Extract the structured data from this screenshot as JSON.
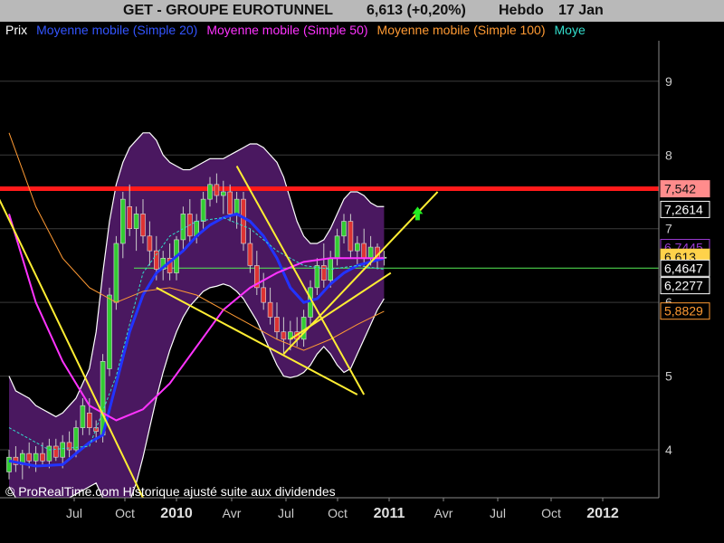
{
  "header": {
    "title": "GET - GROUPE EUROTUNNEL",
    "price": "6,613 (+0,20%)",
    "period": "Hebdo",
    "date": "17 Jan"
  },
  "legend": [
    {
      "label": "Prix",
      "color": "#ffffff"
    },
    {
      "label": "Moyenne mobile (Simple 20)",
      "color": "#3355ff"
    },
    {
      "label": "Moyenne mobile (Simple 50)",
      "color": "#ff33ff"
    },
    {
      "label": "Moyenne mobile (Simple 100)",
      "color": "#ff9a33"
    },
    {
      "label": "Moye",
      "color": "#33ddcc"
    }
  ],
  "footer_note": "© ProRealTime.com Historique ajusté suite aux dividendes",
  "chart_data": {
    "type": "candlestick",
    "ylim": [
      3.35,
      9.55
    ],
    "y_ticks": [
      4,
      5,
      6,
      7,
      8,
      9
    ],
    "x_ticks": [
      {
        "label": "Jul",
        "bold": false
      },
      {
        "label": "Oct",
        "bold": false
      },
      {
        "label": "2010",
        "bold": true
      },
      {
        "label": "Avr",
        "bold": false
      },
      {
        "label": "Jul",
        "bold": false
      },
      {
        "label": "Oct",
        "bold": false
      },
      {
        "label": "2011",
        "bold": true
      },
      {
        "label": "Avr",
        "bold": false
      },
      {
        "label": "Jul",
        "bold": false
      },
      {
        "label": "Oct",
        "bold": false
      },
      {
        "label": "2012",
        "bold": true
      }
    ],
    "horizontal_lines": [
      {
        "value": 7.542,
        "color": "#ff1a1a"
      },
      {
        "value": 6.4647,
        "color": "#55ee55"
      }
    ],
    "price_labels": [
      {
        "text": "7,542",
        "value": 7.542,
        "bg": "#ff8c8c",
        "fg": "#111111",
        "border": "#ff8c8c"
      },
      {
        "text": "7,2614",
        "value": 7.2614,
        "bg": "#000000",
        "fg": "#ffffff",
        "border": "#ffffff"
      },
      {
        "text": "6,7445",
        "value": 6.7445,
        "bg": "#000000",
        "fg": "#9a3ad0",
        "border": "#9a3ad0"
      },
      {
        "text": "6,613",
        "value": 6.613,
        "bg": "#ffd24a",
        "fg": "#111111",
        "border": "#ffd24a"
      },
      {
        "text": "6,4647",
        "value": 6.4647,
        "bg": "#000000",
        "fg": "#ffffff",
        "border": "#ffffff"
      },
      {
        "text": "6,2277",
        "value": 6.2277,
        "bg": "#000000",
        "fg": "#ffffff",
        "border": "#ffffff"
      },
      {
        "text": "5,8829",
        "value": 5.8829,
        "bg": "#000000",
        "fg": "#ff9a33",
        "border": "#ff9a33"
      }
    ],
    "bollinger_upper": [
      [
        0,
        5.0
      ],
      [
        1,
        4.8
      ],
      [
        2,
        4.75
      ],
      [
        3,
        4.7
      ],
      [
        4,
        4.6
      ],
      [
        5,
        4.55
      ],
      [
        6,
        4.5
      ],
      [
        7,
        4.45
      ],
      [
        8,
        4.5
      ],
      [
        9,
        4.6
      ],
      [
        10,
        4.7
      ],
      [
        11,
        4.9
      ],
      [
        12,
        5.1
      ],
      [
        13,
        5.6
      ],
      [
        14,
        6.4
      ],
      [
        15,
        7.1
      ],
      [
        16,
        7.6
      ],
      [
        17,
        7.9
      ],
      [
        18,
        8.1
      ],
      [
        19,
        8.2
      ],
      [
        20,
        8.3
      ],
      [
        21,
        8.3
      ],
      [
        22,
        8.2
      ],
      [
        23,
        8.0
      ],
      [
        24,
        7.9
      ],
      [
        25,
        7.85
      ],
      [
        26,
        7.8
      ],
      [
        27,
        7.8
      ],
      [
        28,
        7.85
      ],
      [
        29,
        7.9
      ],
      [
        30,
        7.95
      ],
      [
        31,
        7.95
      ],
      [
        32,
        7.95
      ],
      [
        33,
        8.0
      ],
      [
        34,
        8.05
      ],
      [
        35,
        8.1
      ],
      [
        36,
        8.15
      ],
      [
        37,
        8.15
      ],
      [
        38,
        8.1
      ],
      [
        39,
        8.0
      ],
      [
        40,
        7.9
      ],
      [
        41,
        7.7
      ],
      [
        42,
        7.4
      ],
      [
        43,
        7.1
      ],
      [
        44,
        6.9
      ],
      [
        45,
        6.8
      ],
      [
        46,
        6.8
      ],
      [
        47,
        6.85
      ],
      [
        48,
        7.0
      ],
      [
        49,
        7.2
      ],
      [
        50,
        7.4
      ],
      [
        51,
        7.5
      ],
      [
        52,
        7.5
      ],
      [
        53,
        7.45
      ],
      [
        54,
        7.35
      ],
      [
        55,
        7.3
      ],
      [
        56,
        7.3
      ]
    ],
    "bollinger_lower": [
      [
        0,
        3.5
      ],
      [
        1,
        3.35
      ],
      [
        2,
        3.3
      ],
      [
        3,
        3.28
      ],
      [
        4,
        3.26
      ],
      [
        5,
        3.25
      ],
      [
        6,
        3.25
      ],
      [
        7,
        3.27
      ],
      [
        8,
        3.3
      ],
      [
        9,
        3.35
      ],
      [
        10,
        3.4
      ],
      [
        11,
        3.45
      ],
      [
        12,
        3.5
      ],
      [
        13,
        3.55
      ],
      [
        14,
        3.35
      ],
      [
        15,
        3.0
      ],
      [
        16,
        2.95
      ],
      [
        17,
        3.1
      ],
      [
        18,
        3.3
      ],
      [
        19,
        3.55
      ],
      [
        20,
        3.9
      ],
      [
        21,
        4.3
      ],
      [
        22,
        4.7
      ],
      [
        23,
        5.05
      ],
      [
        24,
        5.35
      ],
      [
        25,
        5.6
      ],
      [
        26,
        5.8
      ],
      [
        27,
        5.95
      ],
      [
        28,
        6.05
      ],
      [
        29,
        6.15
      ],
      [
        30,
        6.2
      ],
      [
        31,
        6.22
      ],
      [
        32,
        6.25
      ],
      [
        33,
        6.22
      ],
      [
        34,
        6.15
      ],
      [
        35,
        6.05
      ],
      [
        36,
        5.9
      ],
      [
        37,
        5.75
      ],
      [
        38,
        5.55
      ],
      [
        39,
        5.35
      ],
      [
        40,
        5.15
      ],
      [
        41,
        5.0
      ],
      [
        42,
        4.98
      ],
      [
        43,
        5.0
      ],
      [
        44,
        5.05
      ],
      [
        45,
        5.15
      ],
      [
        46,
        5.3
      ],
      [
        47,
        5.4
      ],
      [
        48,
        5.3
      ],
      [
        49,
        5.15
      ],
      [
        50,
        5.05
      ],
      [
        51,
        5.1
      ],
      [
        52,
        5.3
      ],
      [
        53,
        5.5
      ],
      [
        54,
        5.7
      ],
      [
        55,
        5.9
      ],
      [
        56,
        6.05
      ]
    ],
    "candles": [
      [
        0,
        3.7,
        4.0,
        3.6,
        3.9
      ],
      [
        1,
        3.9,
        4.05,
        3.7,
        3.8
      ],
      [
        2,
        3.8,
        4.0,
        3.6,
        3.95
      ],
      [
        3,
        3.95,
        4.1,
        3.75,
        3.85
      ],
      [
        4,
        3.85,
        4.05,
        3.7,
        3.95
      ],
      [
        5,
        3.95,
        4.1,
        3.8,
        3.85
      ],
      [
        6,
        3.85,
        4.15,
        3.75,
        4.05
      ],
      [
        7,
        4.05,
        4.15,
        3.85,
        3.9
      ],
      [
        8,
        3.9,
        4.2,
        3.75,
        4.1
      ],
      [
        9,
        4.1,
        4.25,
        3.9,
        4.0
      ],
      [
        10,
        4.0,
        4.4,
        3.9,
        4.3
      ],
      [
        11,
        4.3,
        4.7,
        4.2,
        4.6
      ],
      [
        12,
        4.5,
        4.7,
        4.2,
        4.3
      ],
      [
        13,
        4.3,
        4.4,
        4.1,
        4.25
      ],
      [
        14,
        4.2,
        5.3,
        4.1,
        5.2
      ],
      [
        15,
        5.1,
        6.2,
        5.0,
        6.1
      ],
      [
        16,
        6.0,
        6.9,
        5.9,
        6.8
      ],
      [
        17,
        6.8,
        7.5,
        6.6,
        7.4
      ],
      [
        18,
        7.3,
        7.6,
        6.9,
        7.0
      ],
      [
        19,
        7.0,
        7.3,
        6.7,
        7.2
      ],
      [
        20,
        7.2,
        7.4,
        6.8,
        6.9
      ],
      [
        21,
        6.9,
        7.1,
        6.5,
        6.7
      ],
      [
        22,
        6.7,
        6.9,
        6.3,
        6.45
      ],
      [
        23,
        6.45,
        6.7,
        6.3,
        6.6
      ],
      [
        24,
        6.6,
        6.8,
        6.3,
        6.4
      ],
      [
        25,
        6.4,
        6.9,
        6.3,
        6.85
      ],
      [
        26,
        6.85,
        7.3,
        6.7,
        7.2
      ],
      [
        27,
        7.2,
        7.4,
        6.8,
        6.9
      ],
      [
        28,
        6.9,
        7.2,
        6.8,
        7.1
      ],
      [
        29,
        7.1,
        7.5,
        7.0,
        7.4
      ],
      [
        30,
        7.4,
        7.7,
        7.3,
        7.6
      ],
      [
        31,
        7.6,
        7.75,
        7.35,
        7.45
      ],
      [
        32,
        7.45,
        7.65,
        7.2,
        7.5
      ],
      [
        33,
        7.5,
        7.6,
        7.1,
        7.2
      ],
      [
        34,
        7.2,
        7.5,
        7.0,
        7.4
      ],
      [
        35,
        7.4,
        7.5,
        6.7,
        6.8
      ],
      [
        36,
        6.8,
        7.0,
        6.4,
        6.5
      ],
      [
        37,
        6.5,
        6.7,
        6.1,
        6.2
      ],
      [
        38,
        6.2,
        6.4,
        5.9,
        6.0
      ],
      [
        39,
        6.0,
        6.2,
        5.7,
        5.8
      ],
      [
        40,
        5.8,
        6.0,
        5.5,
        5.6
      ],
      [
        41,
        5.6,
        5.8,
        5.3,
        5.5
      ],
      [
        42,
        5.5,
        5.75,
        5.35,
        5.6
      ],
      [
        43,
        5.6,
        5.8,
        5.4,
        5.5
      ],
      [
        44,
        5.5,
        5.9,
        5.4,
        5.8
      ],
      [
        45,
        5.8,
        6.3,
        5.7,
        6.2
      ],
      [
        46,
        6.2,
        6.6,
        6.1,
        6.5
      ],
      [
        47,
        6.5,
        6.8,
        6.2,
        6.3
      ],
      [
        48,
        6.3,
        6.7,
        6.2,
        6.6
      ],
      [
        49,
        6.6,
        7.0,
        6.5,
        6.9
      ],
      [
        50,
        6.9,
        7.2,
        6.8,
        7.1
      ],
      [
        51,
        7.1,
        7.2,
        6.6,
        6.7
      ],
      [
        52,
        6.7,
        6.9,
        6.5,
        6.8
      ],
      [
        53,
        6.8,
        7.0,
        6.5,
        6.6
      ],
      [
        54,
        6.6,
        6.9,
        6.5,
        6.75
      ],
      [
        55,
        6.75,
        6.8,
        6.45,
        6.6
      ],
      [
        56,
        6.6,
        6.7,
        6.5,
        6.613
      ]
    ],
    "series": [
      {
        "name": "Moyenne mobile (Simple 20)",
        "color": "#2233ff",
        "width": 3,
        "points": [
          [
            0,
            3.85
          ],
          [
            4,
            3.78
          ],
          [
            8,
            3.8
          ],
          [
            12,
            4.1
          ],
          [
            14,
            4.2
          ],
          [
            16,
            4.9
          ],
          [
            18,
            5.6
          ],
          [
            20,
            6.1
          ],
          [
            22,
            6.4
          ],
          [
            24,
            6.55
          ],
          [
            26,
            6.7
          ],
          [
            28,
            6.9
          ],
          [
            30,
            7.05
          ],
          [
            32,
            7.15
          ],
          [
            34,
            7.2
          ],
          [
            36,
            7.1
          ],
          [
            38,
            6.9
          ],
          [
            40,
            6.6
          ],
          [
            42,
            6.2
          ],
          [
            44,
            6.0
          ],
          [
            46,
            6.05
          ],
          [
            48,
            6.25
          ],
          [
            50,
            6.4
          ],
          [
            52,
            6.5
          ],
          [
            54,
            6.55
          ],
          [
            56,
            6.6
          ]
        ]
      },
      {
        "name": "Moyenne mobile (Simple 50)",
        "color": "#ff33ff",
        "width": 2,
        "points": [
          [
            0,
            7.2
          ],
          [
            4,
            6.0
          ],
          [
            8,
            5.2
          ],
          [
            12,
            4.6
          ],
          [
            16,
            4.4
          ],
          [
            20,
            4.55
          ],
          [
            24,
            4.9
          ],
          [
            28,
            5.4
          ],
          [
            32,
            5.9
          ],
          [
            36,
            6.2
          ],
          [
            40,
            6.4
          ],
          [
            44,
            6.55
          ],
          [
            48,
            6.6
          ],
          [
            52,
            6.6
          ],
          [
            56,
            6.6
          ]
        ]
      },
      {
        "name": "Moyenne mobile (Simple 100)",
        "color": "#ff9a33",
        "width": 1,
        "points": [
          [
            0,
            8.3
          ],
          [
            4,
            7.3
          ],
          [
            8,
            6.6
          ],
          [
            12,
            6.2
          ],
          [
            16,
            6.0
          ],
          [
            20,
            6.15
          ],
          [
            24,
            6.2
          ],
          [
            28,
            6.1
          ],
          [
            32,
            5.9
          ],
          [
            36,
            5.7
          ],
          [
            40,
            5.5
          ],
          [
            44,
            5.35
          ],
          [
            48,
            5.5
          ],
          [
            52,
            5.7
          ],
          [
            56,
            5.88
          ]
        ]
      },
      {
        "name": "Moye",
        "color": "#33ddcc",
        "width": 1,
        "points": [
          [
            0,
            4.3
          ],
          [
            6,
            4.0
          ],
          [
            12,
            4.05
          ],
          [
            16,
            5.0
          ],
          [
            20,
            6.4
          ],
          [
            24,
            6.9
          ],
          [
            28,
            7.1
          ],
          [
            32,
            7.15
          ],
          [
            36,
            7.0
          ],
          [
            40,
            6.7
          ],
          [
            44,
            6.5
          ],
          [
            48,
            6.45
          ],
          [
            52,
            6.5
          ],
          [
            56,
            6.45
          ]
        ]
      }
    ],
    "trendlines": [
      {
        "from": [
          -2,
          7.5
        ],
        "to": [
          20,
          3.35
        ]
      },
      {
        "from": [
          22,
          6.2
        ],
        "to": [
          52,
          4.75
        ]
      },
      {
        "from": [
          34,
          7.85
        ],
        "to": [
          53,
          4.75
        ]
      },
      {
        "from": [
          41,
          5.3
        ],
        "to": [
          64,
          7.5
        ]
      },
      {
        "from": [
          42,
          5.5
        ],
        "to": [
          57,
          6.4
        ]
      }
    ],
    "arrow": {
      "x": 61,
      "y": 7.2,
      "color": "#22ee22"
    }
  }
}
